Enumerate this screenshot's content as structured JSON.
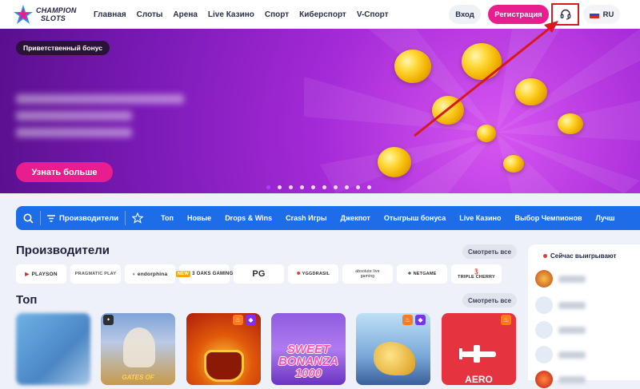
{
  "header": {
    "logo_line1": "CHAMPION",
    "logo_line2": "SLOTS",
    "nav": [
      "Главная",
      "Слоты",
      "Арена",
      "Live Казино",
      "Спорт",
      "Киберспорт",
      "V-Спорт"
    ],
    "login_label": "Вход",
    "register_label": "Регистрация",
    "lang_label": "RU"
  },
  "banner": {
    "badge": "Приветственный бонус",
    "cta_label": "Узнать больше",
    "slide_count": 10,
    "active_slide": 1
  },
  "categories": {
    "providers_label": "Производители",
    "items": [
      "Топ",
      "Новые",
      "Drops & Wins",
      "Crash Игры",
      "Джекпот",
      "Отыгрыш бонуса",
      "Live Казино",
      "Выбор Чемпионов",
      "Лучш"
    ]
  },
  "providers_section": {
    "title": "Производители",
    "see_all": "Смотреть все",
    "logos": [
      "PLAYSON",
      "PRAGMATIC PLAY",
      "endorphina",
      "3 OAKS GAMING",
      "PG",
      "YGGDRASIL",
      "absolute live gaming",
      "NETGAME",
      "TRIPLE CHERRY"
    ]
  },
  "top_section": {
    "title": "Топ",
    "see_all": "Смотреть все",
    "tiles": [
      {
        "text": ""
      },
      {
        "text": "GATES OF"
      },
      {
        "text": ""
      },
      {
        "text": "SWEET BONANZA 1000"
      },
      {
        "text": ""
      },
      {
        "text": "AERO"
      }
    ]
  },
  "winners": {
    "title": "Сейчас выигрывают",
    "rows": 6
  },
  "colors": {
    "brand_pink": "#e81e8e",
    "category_blue": "#1d6ce8",
    "highlight_red": "#d7191e"
  }
}
